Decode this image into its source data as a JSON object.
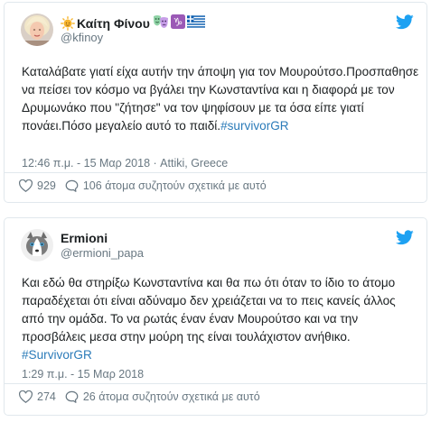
{
  "tweets": [
    {
      "display_name": "Καίτη Φίνου",
      "handle": "@kfinoy",
      "name_decorations": [
        "sun-emoji",
        "theater-masks-emoji",
        "capricorn-emoji",
        "greek-flag-emoji"
      ],
      "body_text": "Καταλάβατε γιατί είχα αυτήν την άποψη για τον Μουρούτσο.Προσπαθησε να πείσει τον κόσμο να βγάλει την Κωνσταντίνα και η διαφορά με τον Δρυμωνάκο που \"ζήτησε\" να τον ψηφίσουν με τα όσα είπε γιατί πονάει.Πόσο μεγαλείο αυτό το παιδί.",
      "hashtag": "#survivorGR",
      "timestamp": "12:46 π.μ. - 15 Μαρ 2018",
      "location_separator": " · ",
      "location": "Attiki, Greece",
      "likes": "929",
      "people_talking": "106 άτομα συζητούν σχετικά με αυτό"
    },
    {
      "display_name": "Ermioni",
      "handle": "@ermioni_papa",
      "body_text": "Και εδώ θα στηρίξω Κωνσταντίνα και θα πω ότι όταν το ίδιο το άτομο παραδέχεται ότι είναι αδύναμο δεν χρειάζεται να το πεις κανείς άλλος από την ομάδα. Το να ρωτάς έναν έναν Μουρούτσο και να την προσβάλεις μεσα στην μούρη της είναι τουλάχιστον ανήθικο. ",
      "hashtag": "#SurvivorGR",
      "timestamp": "1:29 π.μ. - 15 Μαρ 2018",
      "likes": "274",
      "people_talking": "26 άτομα συζητούν σχετικά με αυτό"
    }
  ],
  "colors": {
    "twitter_blue": "#1da1f2",
    "hashtag": "#2b7bb9",
    "muted_text": "#697882",
    "border": "#e1e8ed"
  },
  "icons": [
    "twitter-bird-icon",
    "heart-icon",
    "comment-bubble-icon"
  ]
}
